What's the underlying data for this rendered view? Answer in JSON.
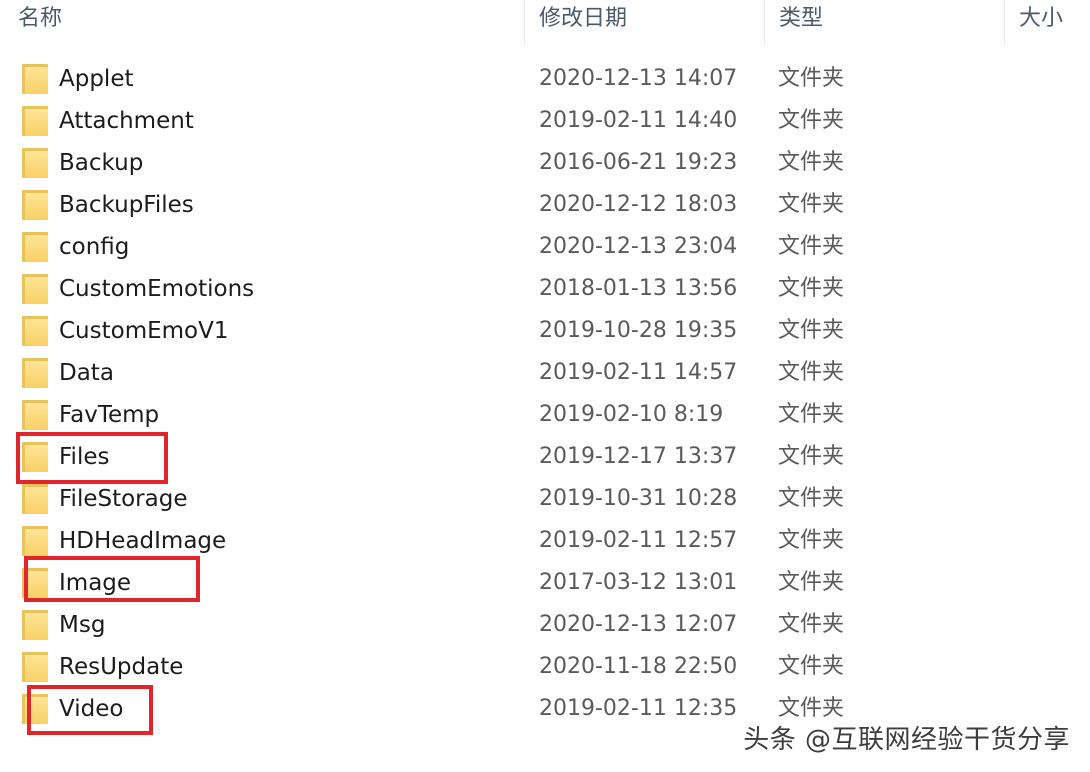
{
  "columns": {
    "name": "名称",
    "date_modified": "修改日期",
    "type": "类型",
    "size": "大小"
  },
  "files": [
    {
      "name": "Applet",
      "date": "2020-12-13 14:07",
      "type": "文件夹",
      "icon": "folder-icon"
    },
    {
      "name": "Attachment",
      "date": "2019-02-11 14:40",
      "type": "文件夹",
      "icon": "folder-icon"
    },
    {
      "name": "Backup",
      "date": "2016-06-21 19:23",
      "type": "文件夹",
      "icon": "folder-icon"
    },
    {
      "name": "BackupFiles",
      "date": "2020-12-12 18:03",
      "type": "文件夹",
      "icon": "folder-icon"
    },
    {
      "name": "config",
      "date": "2020-12-13 23:04",
      "type": "文件夹",
      "icon": "folder-icon"
    },
    {
      "name": "CustomEmotions",
      "date": "2018-01-13 13:56",
      "type": "文件夹",
      "icon": "folder-icon"
    },
    {
      "name": "CustomEmoV1",
      "date": "2019-10-28 19:35",
      "type": "文件夹",
      "icon": "folder-icon"
    },
    {
      "name": "Data",
      "date": "2019-02-11 14:57",
      "type": "文件夹",
      "icon": "folder-icon"
    },
    {
      "name": "FavTemp",
      "date": "2019-02-10 8:19",
      "type": "文件夹",
      "icon": "folder-icon"
    },
    {
      "name": "Files",
      "date": "2019-12-17 13:37",
      "type": "文件夹",
      "icon": "folder-icon"
    },
    {
      "name": "FileStorage",
      "date": "2019-10-31 10:28",
      "type": "文件夹",
      "icon": "folder-icon"
    },
    {
      "name": "HDHeadImage",
      "date": "2019-02-11 12:57",
      "type": "文件夹",
      "icon": "folder-icon"
    },
    {
      "name": "Image",
      "date": "2017-03-12 13:01",
      "type": "文件夹",
      "icon": "folder-icon"
    },
    {
      "name": "Msg",
      "date": "2020-12-13 12:07",
      "type": "文件夹",
      "icon": "folder-icon"
    },
    {
      "name": "ResUpdate",
      "date": "2020-11-18 22:50",
      "type": "文件夹",
      "icon": "folder-icon"
    },
    {
      "name": "Video",
      "date": "2019-02-11 12:35",
      "type": "文件夹",
      "icon": "folder-icon"
    }
  ],
  "highlight_color": "#e0262a",
  "folder_color": "#f7d066",
  "watermark": "头条 @互联网经验干货分享"
}
